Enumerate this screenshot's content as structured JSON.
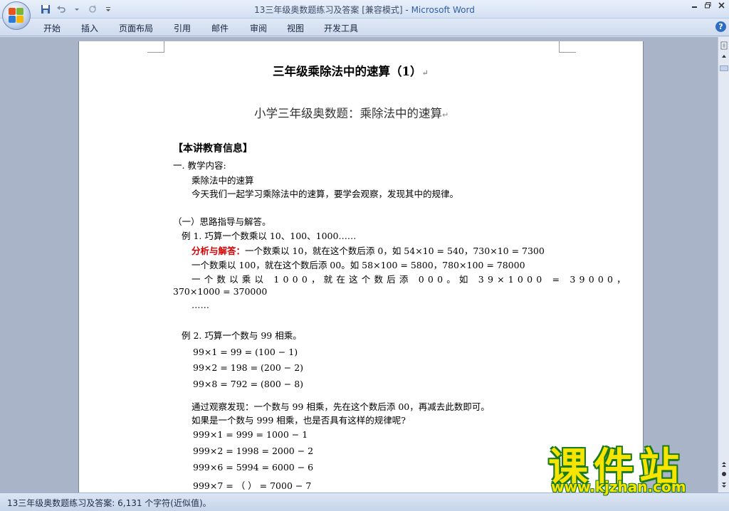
{
  "window": {
    "doc_name": "13三年级奥数题练习及答案",
    "mode": "[兼容模式]",
    "app_name": "Microsoft Word",
    "separator": " - "
  },
  "tabs": [
    "开始",
    "插入",
    "页面布局",
    "引用",
    "邮件",
    "审阅",
    "视图",
    "开发工具"
  ],
  "document": {
    "title": "三年级乘除法中的速算（1）",
    "subtitle": "小学三年级奥数题：乘除法中的速算",
    "section_header": "【本讲教育信息】",
    "l1": "一. 教学内容:",
    "l2": "乘除法中的速算",
    "l3": "今天我们一起学习乘除法中的速算，要学会观察，发现其中的规律。",
    "l4": "（一）思路指导与解答。",
    "l5": "例 1. 巧算一个数乘以 10、100、1000……",
    "l6_label": "分析与解答：",
    "l6": "一个数乘以 10，就在这个数后添 0，如 54×10 = 540，730×10 = 7300",
    "l7": "一个数乘以 100，就在这个数后添 00。如 58×100 = 5800，780×100 = 78000",
    "l8": "一个数以乘以 1000，就在这个数后添 000。如 39×1000 = 39000，",
    "l9": "370×1000 = 370000",
    "l10": "……",
    "l11": "例 2. 巧算一个数与 99 相乘。",
    "l12": "99×1 = 99 = (100 − 1)",
    "l13": "99×2 = 198 = (200 − 2)",
    "l14": "99×8 = 792 = (800 − 8)",
    "l15": "通过观察发现：一个数与 99 相乘，先在这个数后添 00，再减去此数即可。",
    "l16": "如果是一个数与 999 相乘，也是否具有这样的规律呢?",
    "l17": "999×1 = 999 = 1000 − 1",
    "l18": "999×2 = 1998 = 2000 − 2",
    "l19": "999×6 = 5994 = 6000 − 6",
    "l20": "999×7 = （     ） = 7000 − 7"
  },
  "status": {
    "text": "13三年级奥数题练习及答案: 6,131 个字符(近似值)。"
  },
  "watermark": {
    "big": "课件站",
    "url": "www.kjzhan.com"
  }
}
